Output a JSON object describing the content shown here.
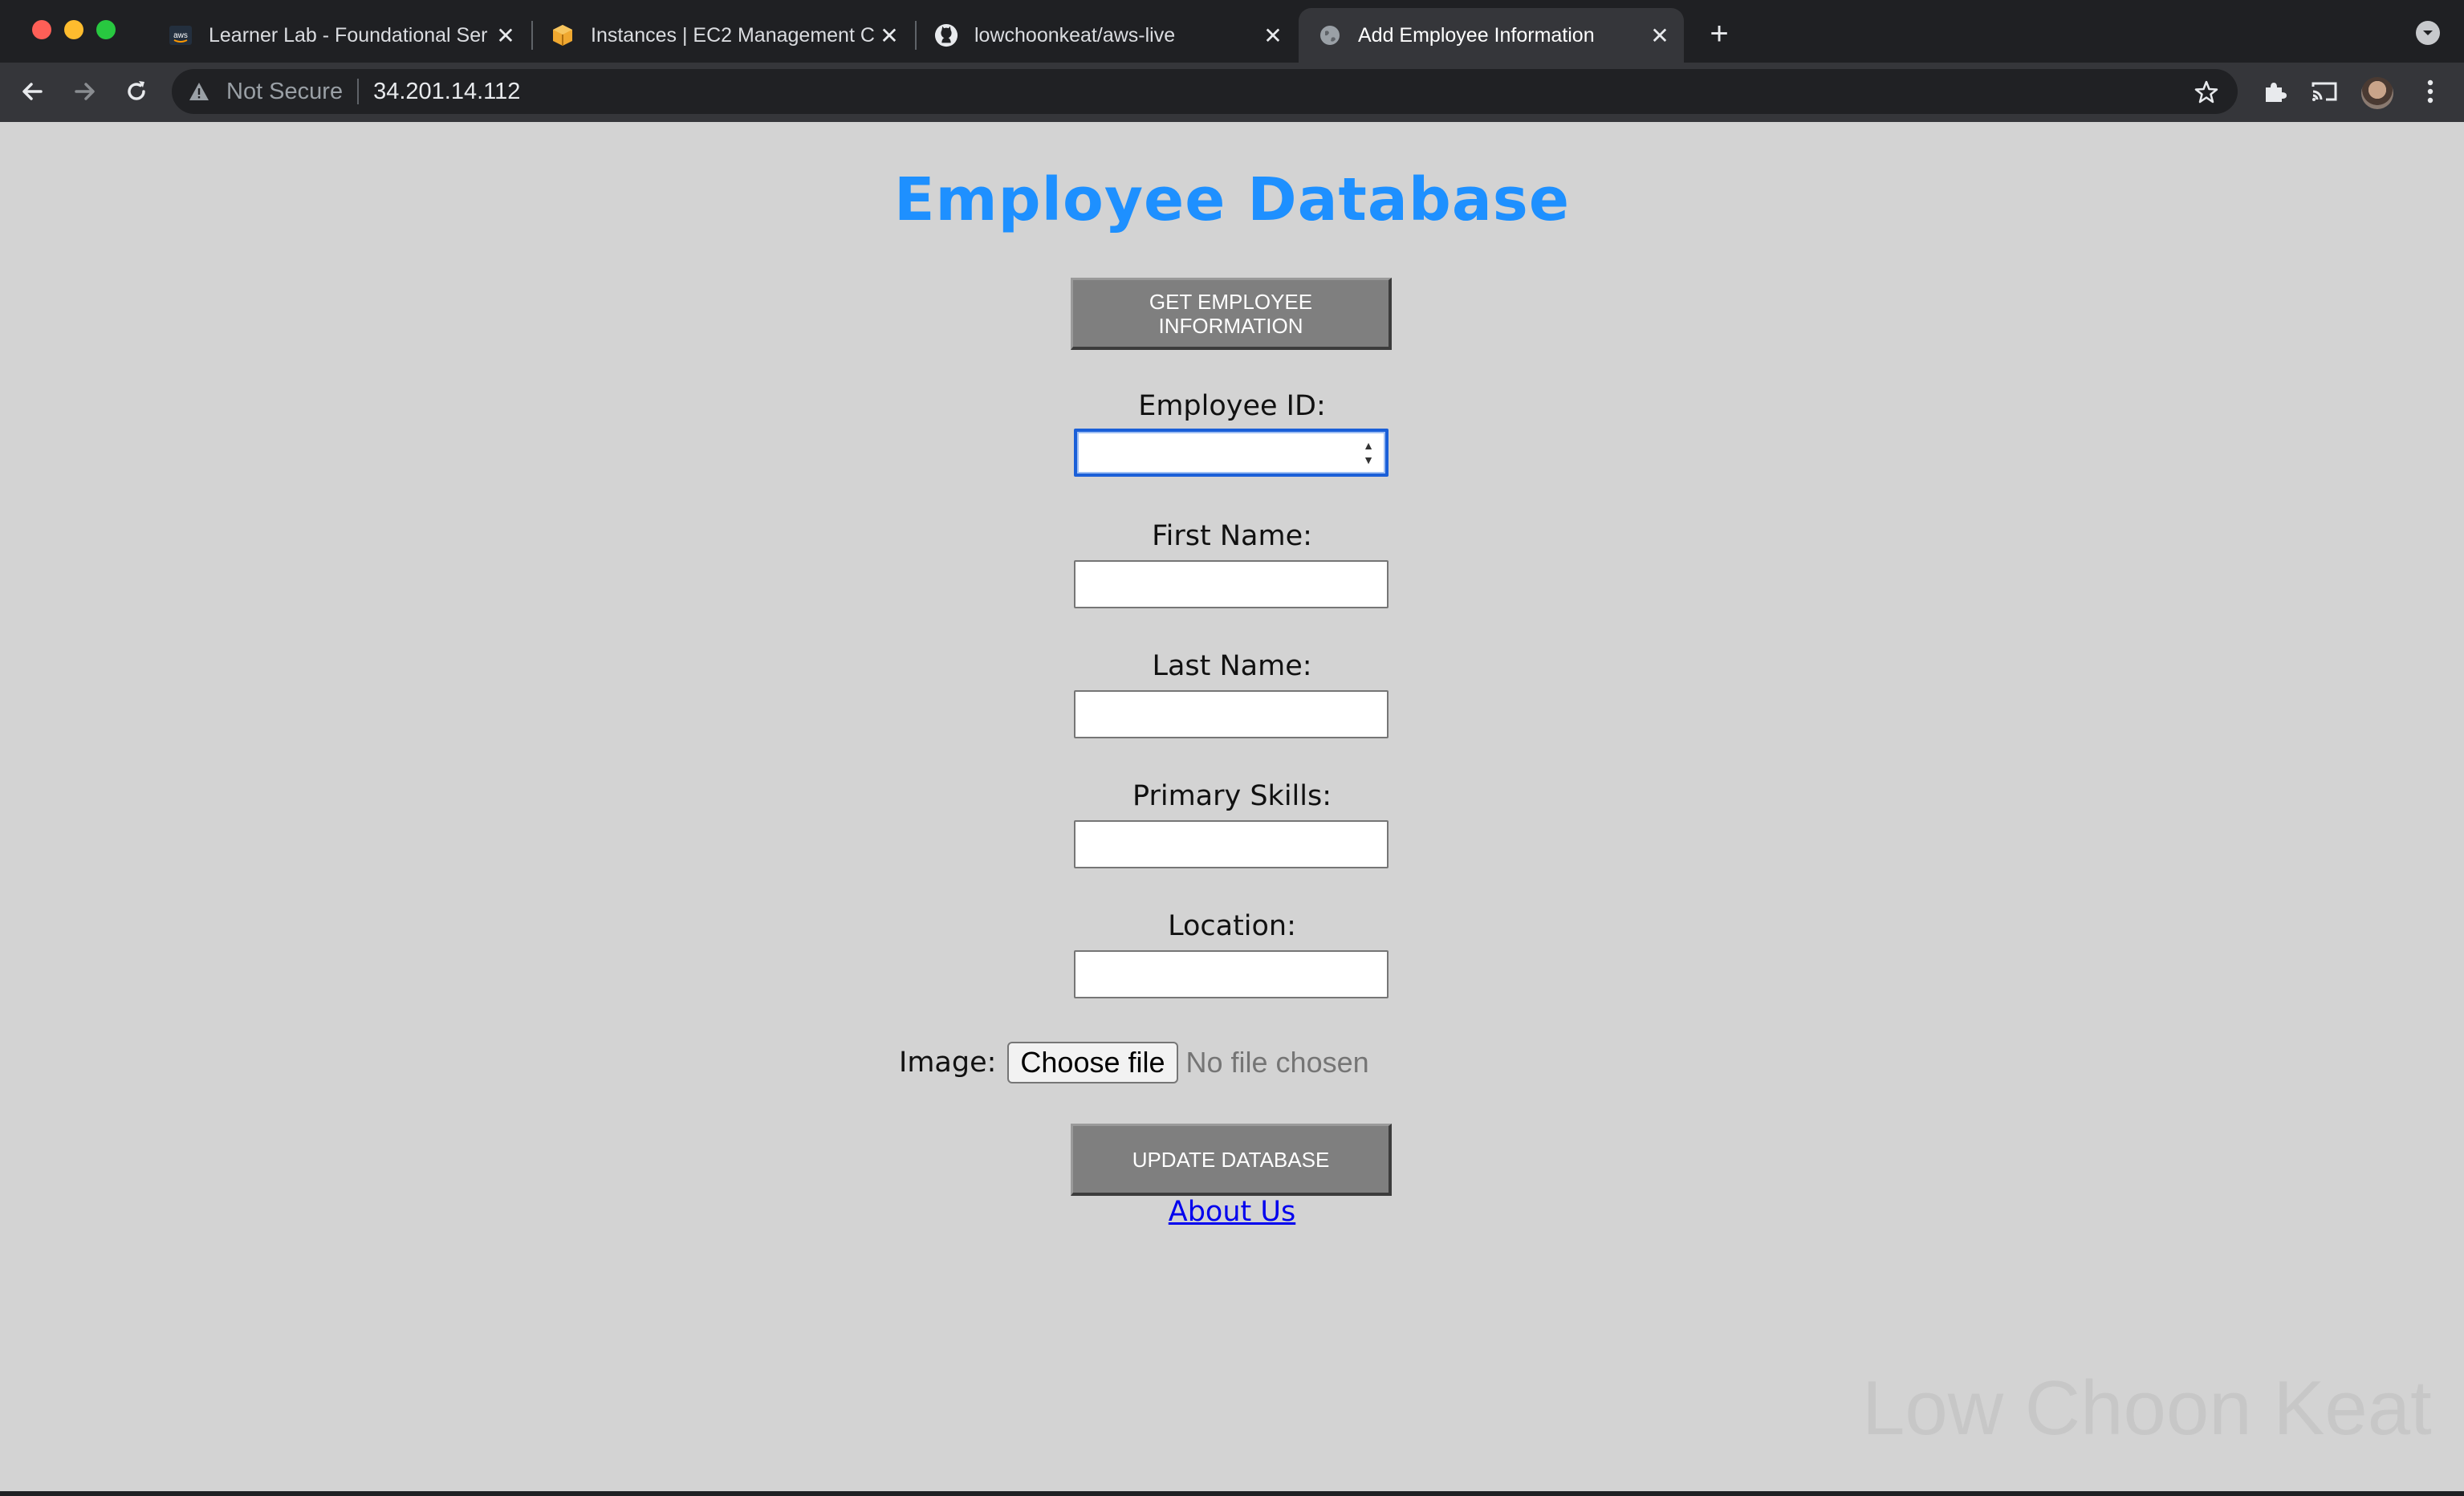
{
  "browser": {
    "tabs": [
      {
        "title": "Learner Lab - Foundational Ser",
        "icon": "aws-icon",
        "active": false
      },
      {
        "title": "Instances | EC2 Management C",
        "icon": "ec2-box-icon",
        "active": false
      },
      {
        "title": "lowchoonkeat/aws-live",
        "icon": "github-icon",
        "active": false
      },
      {
        "title": "Add Employee Information",
        "icon": "globe-icon",
        "active": true
      }
    ],
    "address_bar": {
      "security_label": "Not Secure",
      "url": "34.201.14.112"
    },
    "colors": {
      "chrome_bg": "#1f2023",
      "toolbar_bg": "#35363a"
    }
  },
  "page": {
    "title": "Employee Database",
    "get_button_label": "GET EMPLOYEE INFORMATION",
    "fields": [
      {
        "label": "Employee ID:",
        "value": "",
        "type": "number",
        "focused": true
      },
      {
        "label": "First Name:",
        "value": "",
        "type": "text"
      },
      {
        "label": "Last Name:",
        "value": "",
        "type": "text"
      },
      {
        "label": "Primary Skills:",
        "value": "",
        "type": "text"
      },
      {
        "label": "Location:",
        "value": "",
        "type": "text"
      }
    ],
    "image_field": {
      "label": "Image:",
      "button_label": "Choose file",
      "status": "No file chosen"
    },
    "update_button_label": "UPDATE DATABASE",
    "about_link": "About Us",
    "watermark": "Low Choon Keat",
    "colors": {
      "background": "#d3d3d3",
      "title": "#1e90ff",
      "button": "#7f7f7f",
      "link": "#0000ee"
    }
  }
}
